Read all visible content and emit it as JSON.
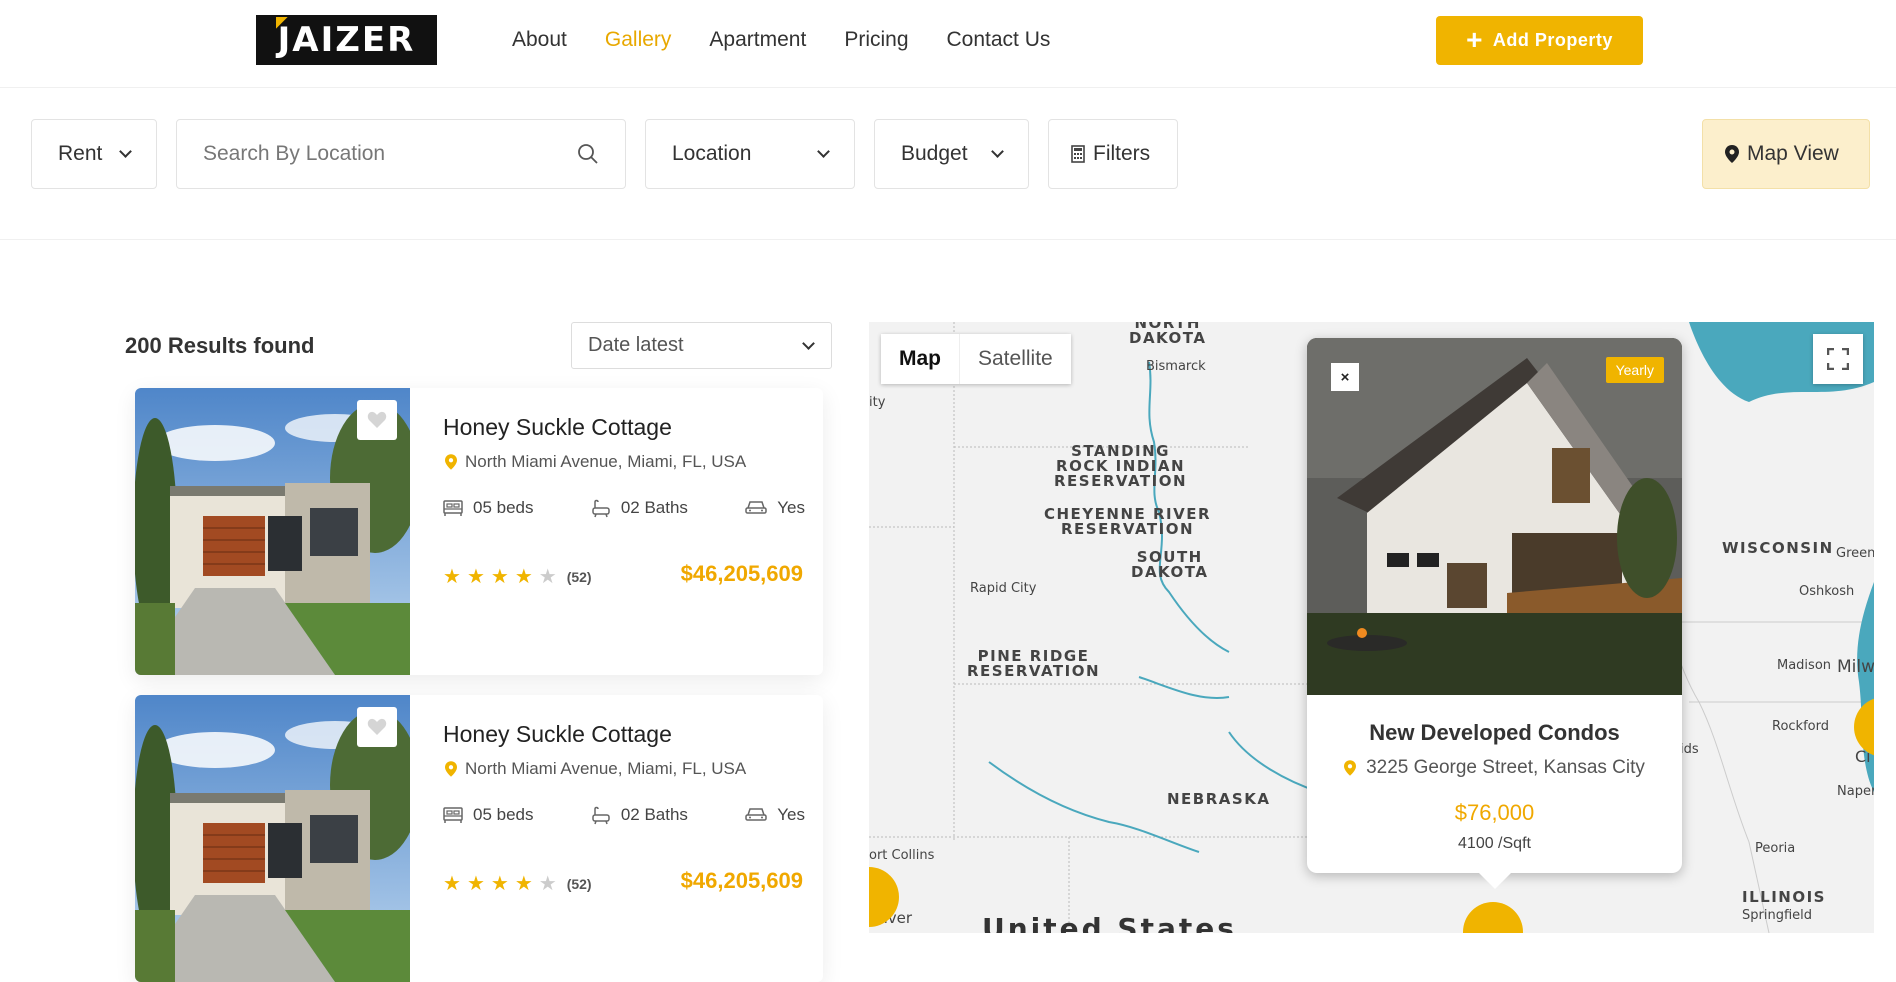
{
  "header": {
    "logo": "JAIZER",
    "nav": [
      "About",
      "Gallery",
      "Apartment",
      "Pricing",
      "Contact Us"
    ],
    "active_nav": "Gallery",
    "add_property": "Add Property"
  },
  "filters": {
    "rent": "Rent",
    "search_placeholder": "Search By Location",
    "location": "Location",
    "budget": "Budget",
    "filters": "Filters",
    "map_view": "Map View"
  },
  "results": {
    "count_text": "200 Results found",
    "sort": "Date latest"
  },
  "listings": [
    {
      "name": "Honey Suckle Cottage",
      "address": "North Miami Avenue, Miami, FL, USA",
      "beds": "05 beds",
      "baths": "02 Baths",
      "parking": "Yes",
      "rating": 4,
      "reviews": "(52)",
      "price": "$46,205,609"
    },
    {
      "name": "Honey Suckle Cottage",
      "address": "North Miami Avenue, Miami, FL, USA",
      "beds": "05 beds",
      "baths": "02 Baths",
      "parking": "Yes",
      "rating": 4,
      "reviews": "(52)",
      "price": "$46,205,609"
    }
  ],
  "map": {
    "toggle_map": "Map",
    "toggle_satellite": "Satellite",
    "labels": {
      "north_dakota": "NORTH\nDAKOTA",
      "standing_rock": "STANDING\nROCK INDIAN\nRESERVATION",
      "cheyenne": "CHEYENNE RIVER\nRESERVATION",
      "south_dakota": "SOUTH\nDAKOTA",
      "pine_ridge": "PINE RIDGE\nRESERVATION",
      "nebraska": "NEBRASKA",
      "wisconsin": "WISCONSIN",
      "illinois": "ILLINOIS",
      "united_states": "United States"
    },
    "cities": {
      "bismarck": "Bismarck",
      "rapid_city": "Rapid City",
      "fort_collins": "ort Collins",
      "denver": "enver",
      "madison": "Madison",
      "milwaukee": "Milwa",
      "rockford": "Rockford",
      "oshkosh": "Oshkosh",
      "green_bay": "Green",
      "naperville": "Napervi",
      "peoria": "Peoria",
      "springfield": "Springfield",
      "chicago": "Ci",
      "ids": "ids",
      "city_edge": "ity"
    },
    "popup": {
      "tag": "Yearly",
      "close": "×",
      "title": "New Developed Condos",
      "address": "3225 George Street, Kansas City",
      "price": "$76,000",
      "area": "4100 /Sqft"
    },
    "colors": {
      "accent": "#f0b400",
      "water": "#4aa8bd"
    }
  }
}
